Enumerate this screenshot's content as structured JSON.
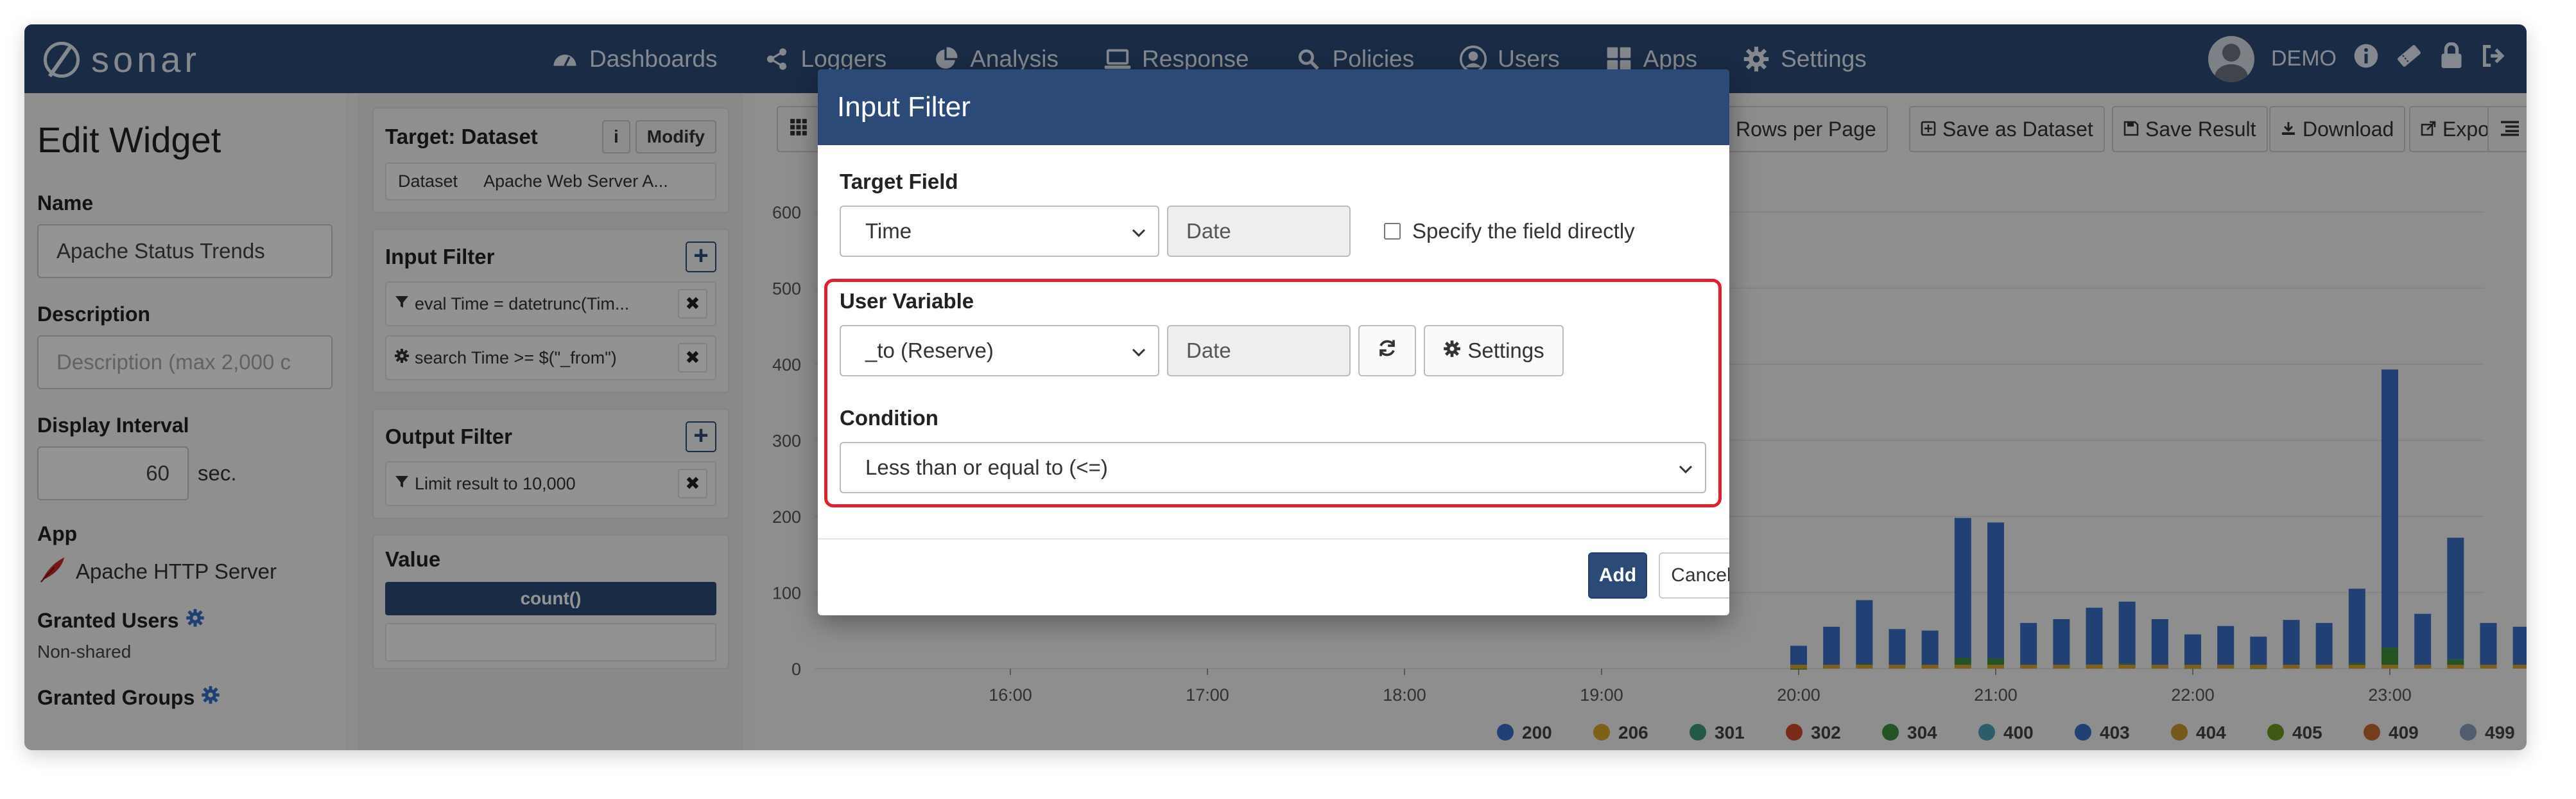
{
  "app": {
    "logo_text": "sonar",
    "brand_color": "#2c4a78",
    "nav": [
      {
        "label": "Dashboards",
        "icon": "dashboard-icon"
      },
      {
        "label": "Loggers",
        "icon": "share-icon"
      },
      {
        "label": "Analysis",
        "icon": "pie-chart-icon"
      },
      {
        "label": "Response",
        "icon": "laptop-icon"
      },
      {
        "label": "Policies",
        "icon": "search-icon"
      },
      {
        "label": "Users",
        "icon": "user-circle-icon"
      },
      {
        "label": "Apps",
        "icon": "grid-icon"
      },
      {
        "label": "Settings",
        "icon": "gear-icon"
      }
    ],
    "user": "DEMO"
  },
  "left_panel": {
    "title": "Edit Widget",
    "name_label": "Name",
    "name_value": "Apache Status Trends",
    "description_label": "Description",
    "description_placeholder": "Description (max 2,000 c",
    "interval_label": "Display Interval",
    "interval_value": "60",
    "interval_unit": "sec.",
    "app_label": "App",
    "app_value": "Apache HTTP Server",
    "granted_users_label": "Granted Users",
    "granted_users_value": "Non-shared",
    "granted_groups_label": "Granted Groups"
  },
  "middle_panel": {
    "target_title": "Target: Dataset",
    "info_btn": "i",
    "modify_btn": "Modify",
    "dataset_key": "Dataset",
    "dataset_value": "Apache Web Server A...",
    "input_filter_title": "Input Filter",
    "input_filters": [
      {
        "icon": "filter-icon",
        "text": "eval Time = datetrunc(Tim..."
      },
      {
        "icon": "gear-icon",
        "text": "search Time >= $(\"_from\")"
      }
    ],
    "output_filter_title": "Output Filter",
    "output_filters": [
      {
        "icon": "filter-icon",
        "text": "Limit result to 10,000"
      }
    ],
    "value_title": "Value",
    "value_item": "count()"
  },
  "toolbar": {
    "rows_per_page": "Rows per Page",
    "save_as_dataset": "Save as Dataset",
    "save_result": "Save Result",
    "download": "Download",
    "export": "Export"
  },
  "chart_data": {
    "type": "bar",
    "stacked": true,
    "ylim": [
      0,
      600
    ],
    "yticks": [
      0,
      100,
      200,
      300,
      400,
      500,
      600
    ],
    "xticks": [
      "16:00",
      "17:00",
      "18:00",
      "19:00",
      "20:00",
      "21:00",
      "22:00",
      "23:00"
    ],
    "legend": [
      "200",
      "206",
      "301",
      "302",
      "304",
      "400",
      "403",
      "404",
      "405",
      "409",
      "499"
    ],
    "legend_colors": [
      "#3a70c9",
      "#d9a52b",
      "#3d9a78",
      "#d24a2b",
      "#3f8f3f",
      "#4ba3b5",
      "#3a70c9",
      "#c99a2e",
      "#6b9a1e",
      "#c9692f",
      "#8aa0bf"
    ],
    "visible_bars_2000_onward": [
      {
        "x": "20:00",
        "value": 30
      },
      {
        "x": "20:10",
        "value": 55
      },
      {
        "x": "20:20",
        "value": 90
      },
      {
        "x": "20:30",
        "value": 52
      },
      {
        "x": "20:40",
        "value": 50
      },
      {
        "x": "20:50",
        "value": 198
      },
      {
        "x": "21:00",
        "value": 192
      },
      {
        "x": "21:10",
        "value": 60
      },
      {
        "x": "21:20",
        "value": 65
      },
      {
        "x": "21:30",
        "value": 80
      },
      {
        "x": "21:40",
        "value": 88
      },
      {
        "x": "21:50",
        "value": 65
      },
      {
        "x": "22:00",
        "value": 45
      },
      {
        "x": "22:10",
        "value": 56
      },
      {
        "x": "22:20",
        "value": 42
      },
      {
        "x": "22:30",
        "value": 64
      },
      {
        "x": "22:40",
        "value": 60
      },
      {
        "x": "22:50",
        "value": 105
      },
      {
        "x": "23:00",
        "value": 393
      },
      {
        "x": "23:10",
        "value": 72
      },
      {
        "x": "23:20",
        "value": 172
      },
      {
        "x": "23:30",
        "value": 60
      },
      {
        "x": "23:40",
        "value": 55
      }
    ]
  },
  "modal": {
    "title": "Input Filter",
    "target_field_label": "Target Field",
    "target_field_value": "Time",
    "target_field_type": "Date",
    "specify_directly_label": "Specify the field directly",
    "user_variable_label": "User Variable",
    "user_variable_value": "_to (Reserve)",
    "user_variable_type": "Date",
    "settings_btn": "Settings",
    "condition_label": "Condition",
    "condition_value": "Less than or equal to (<=)",
    "add_btn": "Add",
    "cancel_btn": "Cancel"
  }
}
